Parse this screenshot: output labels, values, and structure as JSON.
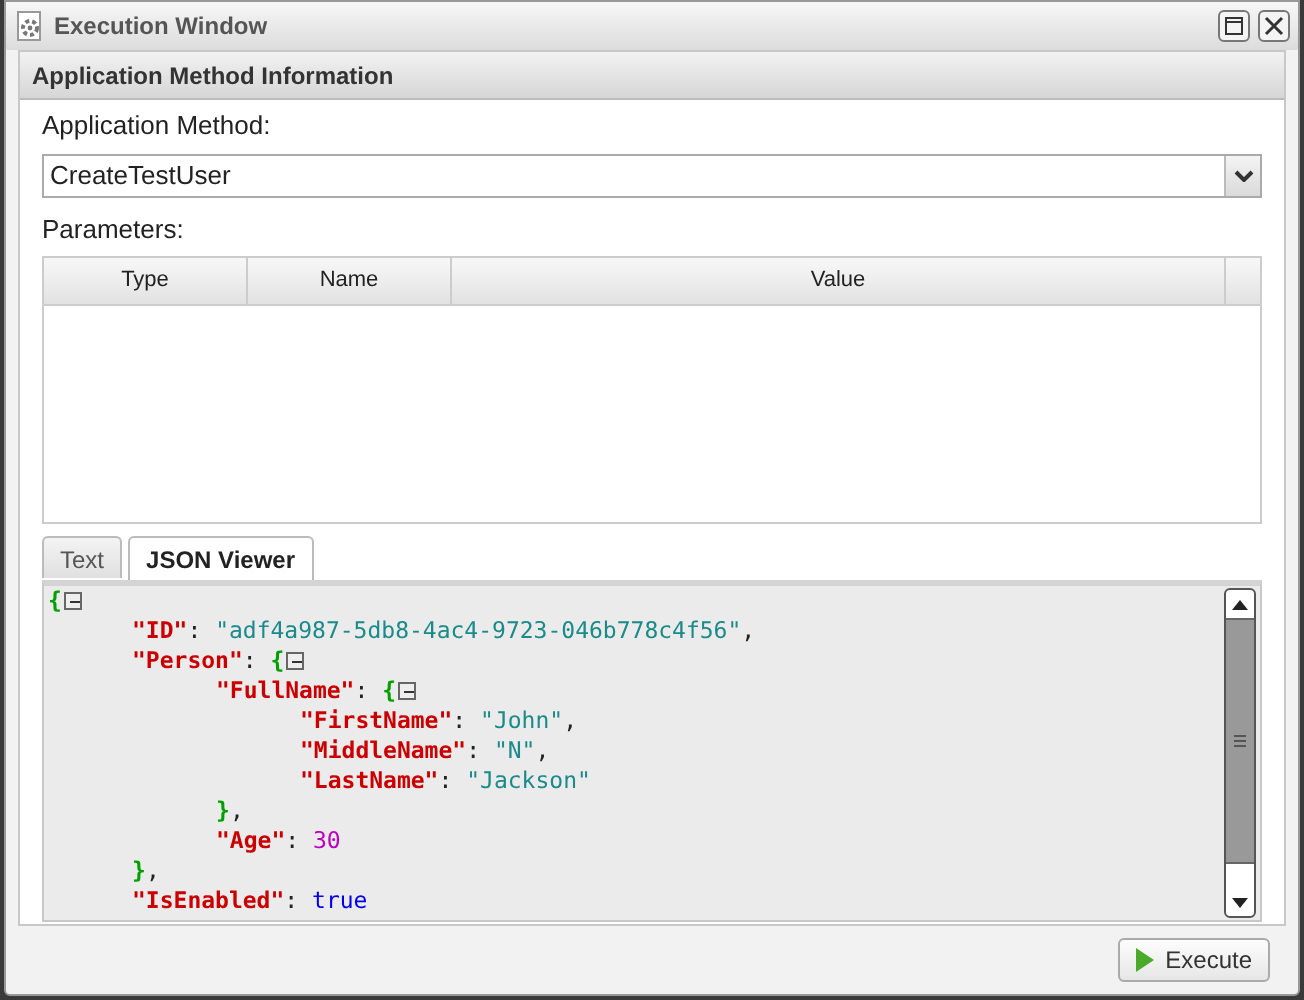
{
  "window": {
    "title": "Execution Window"
  },
  "section": {
    "title": "Application Method Information"
  },
  "method_field": {
    "label": "Application Method:",
    "value": "CreateTestUser"
  },
  "parameters": {
    "label": "Parameters:",
    "columns": [
      "Type",
      "Name",
      "Value"
    ]
  },
  "tabs": [
    {
      "label": "Text",
      "selected": false
    },
    {
      "label": "JSON Viewer",
      "selected": true
    }
  ],
  "json_viewer": {
    "line": [
      {
        "kind": "brace",
        "text": "{"
      }
    ],
    "expanded": true,
    "children": [
      {
        "line": [
          {
            "kind": "key",
            "text": "\"ID\""
          },
          {
            "kind": "punct",
            "text": ": "
          },
          {
            "kind": "string",
            "text": "\"adf4a987-5db8-4ac4-9723-046b778c4f56\""
          },
          {
            "kind": "punct",
            "text": ","
          }
        ]
      },
      {
        "line": [
          {
            "kind": "key",
            "text": "\"Person\""
          },
          {
            "kind": "punct",
            "text": ": "
          },
          {
            "kind": "brace",
            "text": "{"
          }
        ],
        "expanded": true,
        "children": [
          {
            "line": [
              {
                "kind": "key",
                "text": "\"FullName\""
              },
              {
                "kind": "punct",
                "text": ": "
              },
              {
                "kind": "brace",
                "text": "{"
              }
            ],
            "expanded": true,
            "children": [
              {
                "line": [
                  {
                    "kind": "key",
                    "text": "\"FirstName\""
                  },
                  {
                    "kind": "punct",
                    "text": ": "
                  },
                  {
                    "kind": "string",
                    "text": "\"John\""
                  },
                  {
                    "kind": "punct",
                    "text": ","
                  }
                ]
              },
              {
                "line": [
                  {
                    "kind": "key",
                    "text": "\"MiddleName\""
                  },
                  {
                    "kind": "punct",
                    "text": ": "
                  },
                  {
                    "kind": "string",
                    "text": "\"N\""
                  },
                  {
                    "kind": "punct",
                    "text": ","
                  }
                ]
              },
              {
                "line": [
                  {
                    "kind": "key",
                    "text": "\"LastName\""
                  },
                  {
                    "kind": "punct",
                    "text": ": "
                  },
                  {
                    "kind": "string",
                    "text": "\"Jackson\""
                  }
                ]
              }
            ],
            "close": [
              {
                "kind": "brace",
                "text": "}"
              },
              {
                "kind": "punct",
                "text": ","
              }
            ]
          },
          {
            "line": [
              {
                "kind": "key",
                "text": "\"Age\""
              },
              {
                "kind": "punct",
                "text": ": "
              },
              {
                "kind": "number",
                "text": "30"
              }
            ]
          }
        ],
        "close": [
          {
            "kind": "brace",
            "text": "}"
          },
          {
            "kind": "punct",
            "text": ","
          }
        ]
      },
      {
        "line": [
          {
            "kind": "key",
            "text": "\"IsEnabled\""
          },
          {
            "kind": "punct",
            "text": ": "
          },
          {
            "kind": "bool",
            "text": "true"
          }
        ]
      }
    ]
  },
  "buttons": [
    {
      "label": "Execute"
    }
  ]
}
